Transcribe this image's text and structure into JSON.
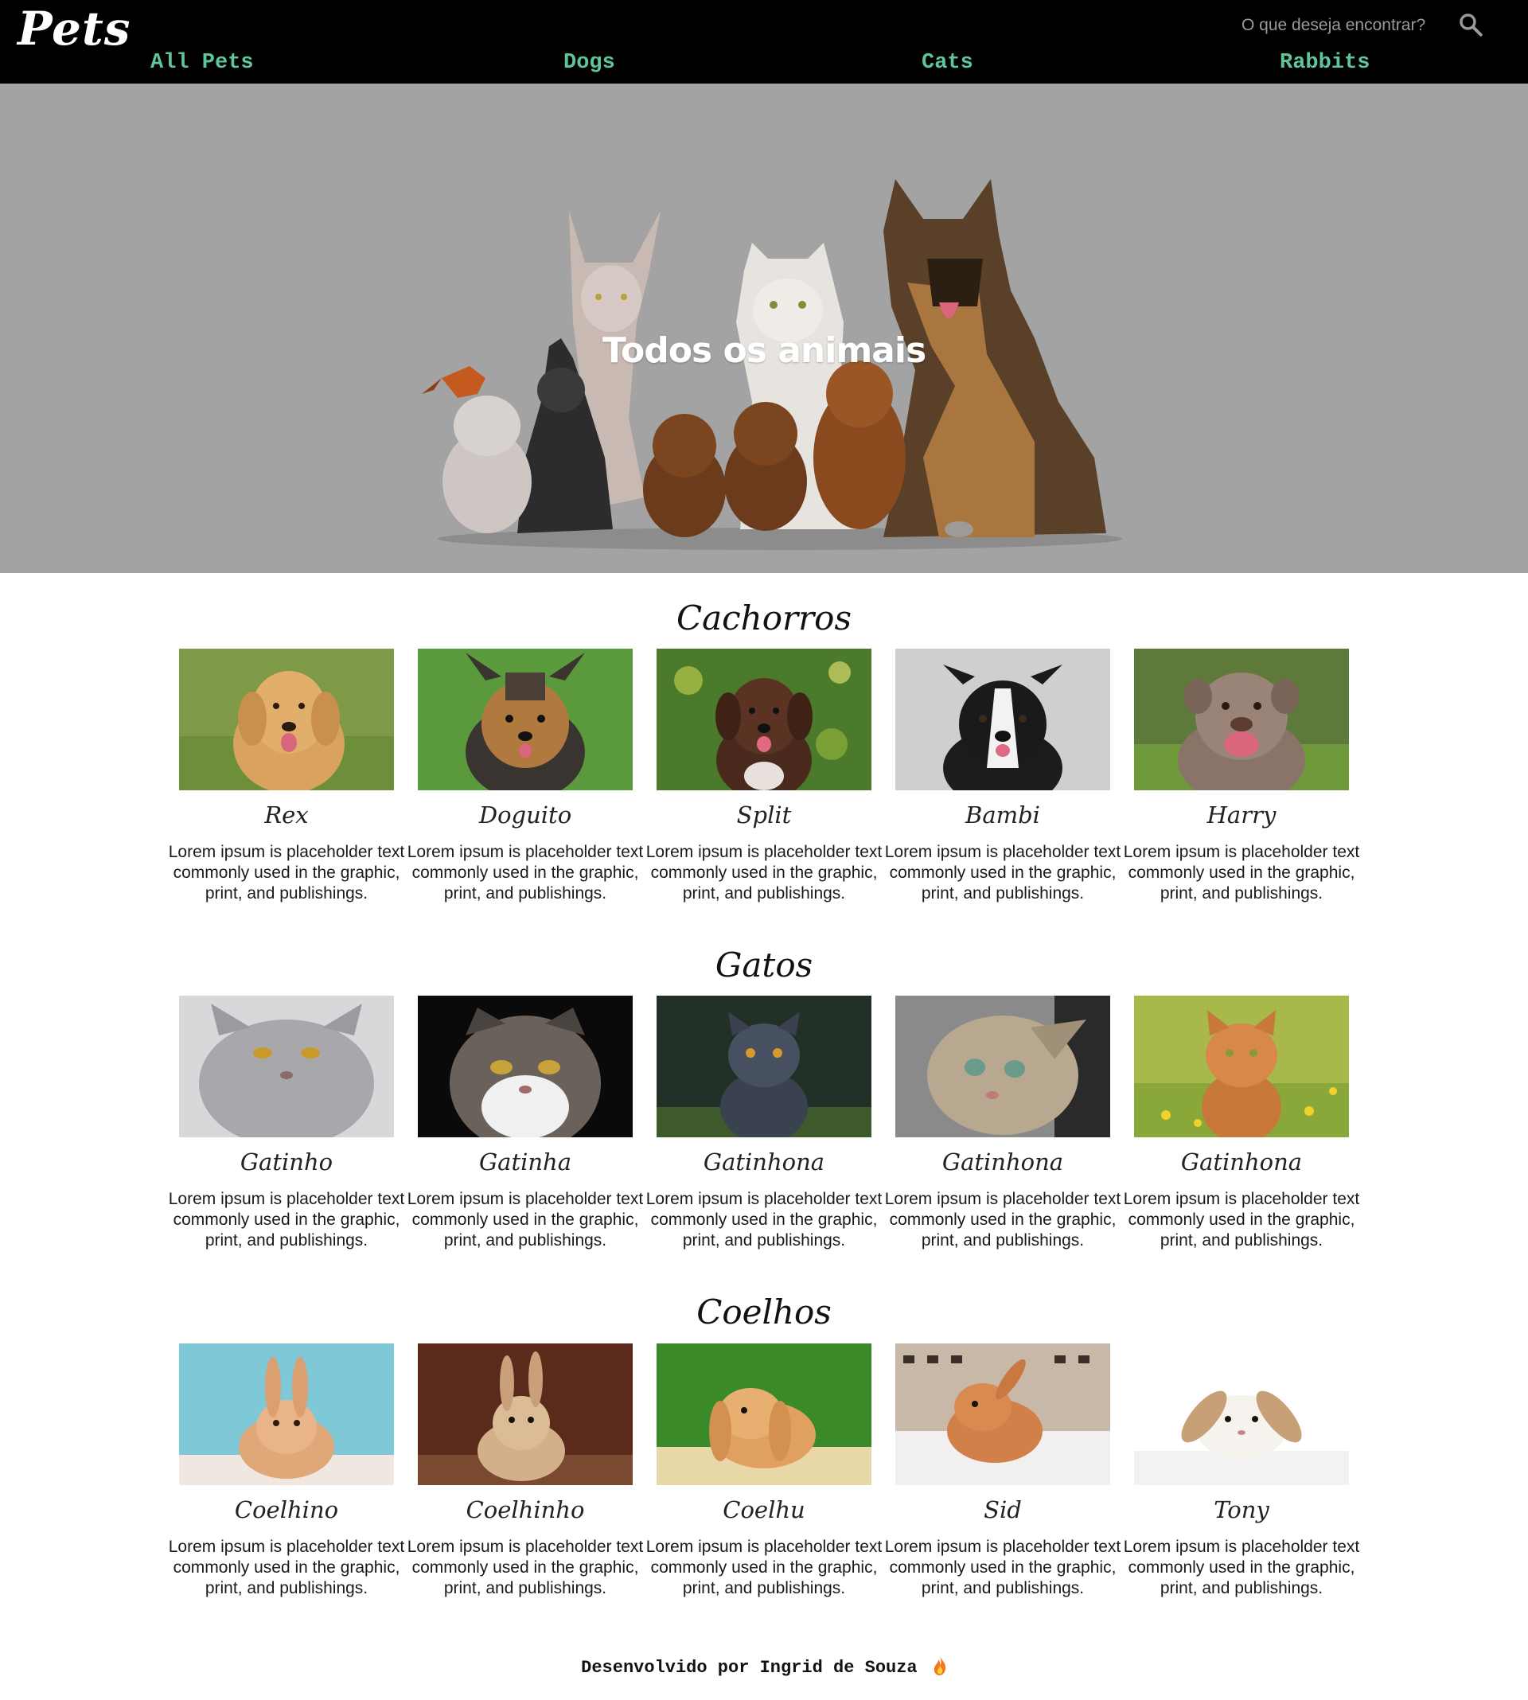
{
  "header": {
    "logo": "Pets",
    "search_placeholder": "O que deseja encontrar?",
    "search_icon": "search-icon",
    "nav": [
      "All Pets",
      "Dogs",
      "Cats",
      "Rabbits"
    ],
    "nav_color": "#5fc69a"
  },
  "hero": {
    "title": "Todos os animais",
    "background": "#a3a3a3"
  },
  "sections": [
    {
      "title": "Cachorros",
      "cards": [
        {
          "name": "Rex",
          "desc": "Lorem ipsum is placeholder text commonly used in the graphic, print, and publishings."
        },
        {
          "name": "Doguito",
          "desc": "Lorem ipsum is placeholder text commonly used in the graphic, print, and publishings."
        },
        {
          "name": "Split",
          "desc": "Lorem ipsum is placeholder text commonly used in the graphic, print, and publishings."
        },
        {
          "name": "Bambi",
          "desc": "Lorem ipsum is placeholder text commonly used in the graphic, print, and publishings."
        },
        {
          "name": "Harry",
          "desc": "Lorem ipsum is placeholder text commonly used in the graphic, print, and publishings."
        }
      ]
    },
    {
      "title": "Gatos",
      "cards": [
        {
          "name": "Gatinho",
          "desc": "Lorem ipsum is placeholder text commonly used in the graphic, print, and publishings."
        },
        {
          "name": "Gatinha",
          "desc": "Lorem ipsum is placeholder text commonly used in the graphic, print, and publishings."
        },
        {
          "name": "Gatinhona",
          "desc": "Lorem ipsum is placeholder text commonly used in the graphic, print, and publishings."
        },
        {
          "name": "Gatinhona",
          "desc": "Lorem ipsum is placeholder text commonly used in the graphic, print, and publishings."
        },
        {
          "name": "Gatinhona",
          "desc": "Lorem ipsum is placeholder text commonly used in the graphic, print, and publishings."
        }
      ]
    },
    {
      "title": "Coelhos",
      "cards": [
        {
          "name": "Coelhino",
          "desc": "Lorem ipsum is placeholder text commonly used in the graphic, print, and publishings."
        },
        {
          "name": "Coelhinho",
          "desc": "Lorem ipsum is placeholder text commonly used in the graphic, print, and publishings."
        },
        {
          "name": "Coelhu",
          "desc": "Lorem ipsum is placeholder text commonly used in the graphic, print, and publishings."
        },
        {
          "name": "Sid",
          "desc": "Lorem ipsum is placeholder text commonly used in the graphic, print, and publishings."
        },
        {
          "name": "Tony",
          "desc": "Lorem ipsum is placeholder text commonly used in the graphic, print, and publishings."
        }
      ]
    }
  ],
  "footer": {
    "text": "Desenvolvido por Ingrid de Souza",
    "icon": "fire-icon"
  }
}
